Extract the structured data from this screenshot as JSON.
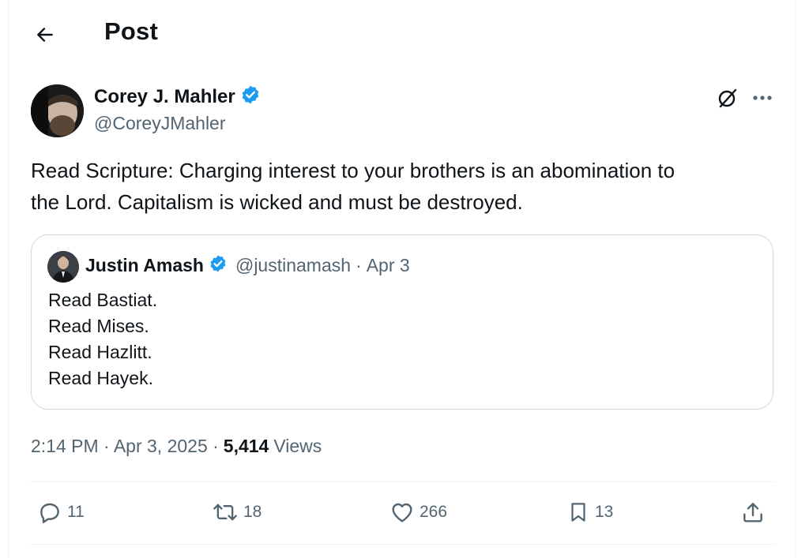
{
  "header": {
    "title": "Post",
    "back_icon": "arrow-left-icon"
  },
  "post": {
    "author": {
      "name": "Corey J. Mahler",
      "handle": "@CoreyJMahler",
      "verified": true
    },
    "text": "Read Scripture: Charging interest to your brothers is an abomination to\nthe Lord. Capitalism is wicked and must be destroyed.",
    "timestamp": "2:14 PM · Apr 3, 2025 ·",
    "views_count": "5,414",
    "views_label": "Views"
  },
  "quote": {
    "name": "Justin Amash",
    "handle": "@justinamash",
    "separator": "·",
    "date": "Apr 3",
    "text": "Read Bastiat.\nRead Mises.\nRead Hazlitt.\nRead Hayek."
  },
  "actions": {
    "replies": "11",
    "reposts": "18",
    "likes": "266",
    "bookmarks": "13"
  },
  "colors": {
    "verified_blue": "#1d9bf0",
    "secondary_text": "#536471",
    "border": "#cfd9de"
  }
}
